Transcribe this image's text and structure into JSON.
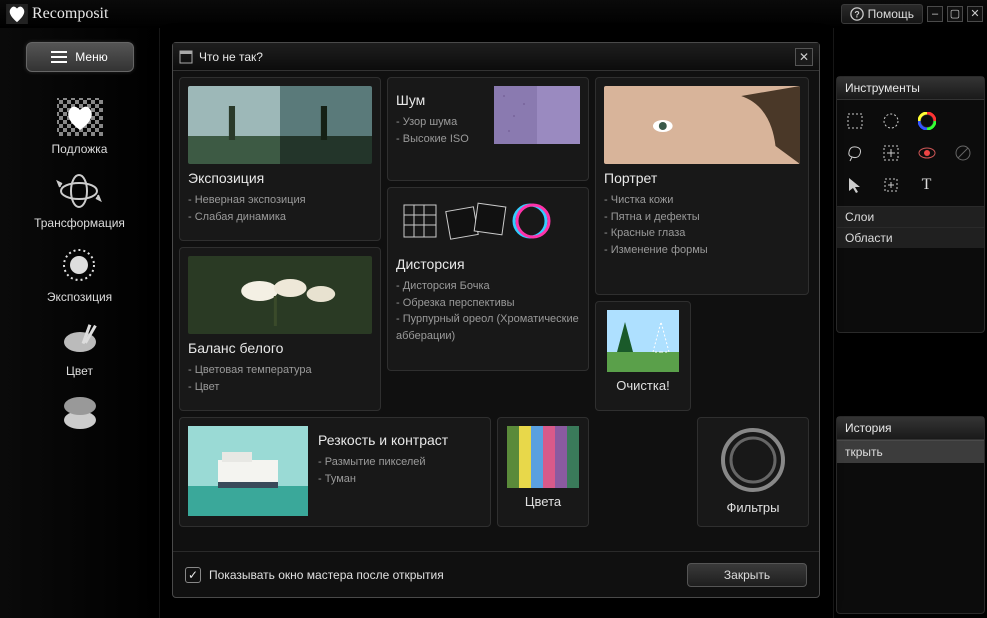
{
  "app": {
    "name": "Recomposit",
    "help_label": "Помощь"
  },
  "sidebar": {
    "menu_label": "Меню",
    "items": [
      {
        "label": "Подложка"
      },
      {
        "label": "Трансформация"
      },
      {
        "label": "Экспозиция"
      },
      {
        "label": "Цвет"
      }
    ]
  },
  "right": {
    "tools_title": "Инструменты",
    "layers_title": "Слои",
    "regions_title": "Области",
    "history_title": "История",
    "history_item": "ткрыть"
  },
  "dialog": {
    "title": "Что не так?",
    "show_on_open": "Показывать окно мастера после открытия",
    "close": "Закрыть",
    "cards": {
      "exposure": {
        "title": "Экспозиция",
        "items": [
          "Неверная экспозиция",
          "Слабая динамика"
        ]
      },
      "noise": {
        "title": "Шум",
        "items": [
          "Узор шума",
          "Высокие ISO"
        ]
      },
      "distortion": {
        "title": "Дисторсия",
        "items": [
          "Дисторсия Бочка",
          "Обрезка перспективы",
          "Пурпурный ореол (Хроматические абберации)"
        ]
      },
      "wb": {
        "title": "Баланс белого",
        "items": [
          "Цветовая температура",
          "Цвет"
        ]
      },
      "portrait": {
        "title": "Портрет",
        "items": [
          "Чистка кожи",
          "Пятна и дефекты",
          "Красные глаза",
          "Изменение формы"
        ]
      },
      "clean": {
        "title": "Очистка!"
      },
      "sharp": {
        "title": "Резкость и контраст",
        "items": [
          "Размытие пикселей",
          "Туман"
        ]
      },
      "colors": {
        "title": "Цвета"
      },
      "filters": {
        "title": "Фильтры"
      }
    }
  }
}
